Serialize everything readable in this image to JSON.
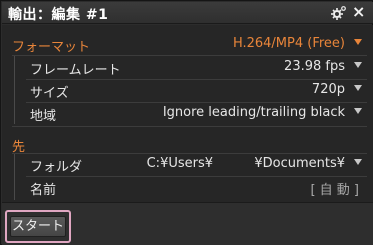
{
  "window": {
    "title": "輸出：編集 #1",
    "gear_icon": "gear-icon",
    "close_icon": "close-icon",
    "close_glyph": "×"
  },
  "format_section": {
    "label": "フォーマット",
    "value": "H.264/MP4 (Free)"
  },
  "format_rows": [
    {
      "label": "フレームレート",
      "value": "23.98 fps"
    },
    {
      "label": "サイズ",
      "value": "720p"
    },
    {
      "label": "地域",
      "value": "Ignore leading/trailing black"
    }
  ],
  "destination_section": {
    "label": "先"
  },
  "destination_rows": [
    {
      "label": "フォルダ",
      "value": "C:¥Users¥          ¥Documents¥"
    },
    {
      "label": "名前",
      "value": "[ 自 動 ]"
    }
  ],
  "footer": {
    "start_label": "スタート"
  },
  "colors": {
    "accent": "#e8853a",
    "highlight_border": "#e0a7c2"
  }
}
